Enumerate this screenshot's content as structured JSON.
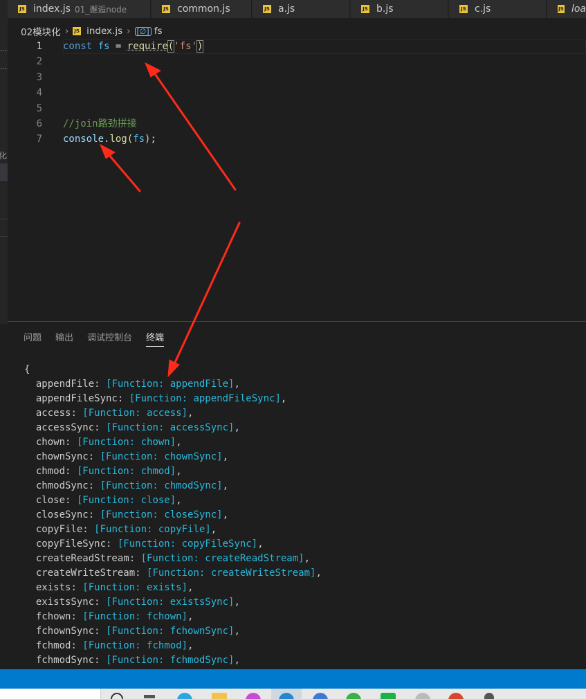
{
  "tabs": [
    {
      "name": "index.js",
      "sub": "01_邂逅node"
    },
    {
      "name": "common.js"
    },
    {
      "name": "a.js"
    },
    {
      "name": "b.js"
    },
    {
      "name": "c.js"
    },
    {
      "name": "loa"
    }
  ],
  "file_badge": "JS",
  "breadcrumb": {
    "folder": "02模块化",
    "file": "index.js",
    "symbol": "fs"
  },
  "left_strip": {
    "ellipsis_1": "...",
    "ellipsis_2": "...",
    "fragment": "化"
  },
  "editor": {
    "line_numbers": [
      "1",
      "2",
      "3",
      "4",
      "5",
      "6",
      "7"
    ],
    "line1": {
      "kw": "const",
      "var": "fs",
      "op": "=",
      "fn": "require",
      "open": "(",
      "str": "'fs'",
      "close": ")"
    },
    "line6": {
      "comment": "//join路劲拼接"
    },
    "line7": {
      "obj": "console",
      "dot": ".",
      "method": "log",
      "open": "(",
      "arg": "fs",
      "close": ");"
    }
  },
  "panel": {
    "tabs": [
      "问题",
      "输出",
      "调试控制台",
      "终端"
    ],
    "active_tab": "终端"
  },
  "terminal": {
    "open_brace": "{",
    "entries": [
      {
        "key": "appendFile",
        "fn": "appendFile"
      },
      {
        "key": "appendFileSync",
        "fn": "appendFileSync"
      },
      {
        "key": "access",
        "fn": "access"
      },
      {
        "key": "accessSync",
        "fn": "accessSync"
      },
      {
        "key": "chown",
        "fn": "chown"
      },
      {
        "key": "chownSync",
        "fn": "chownSync"
      },
      {
        "key": "chmod",
        "fn": "chmod"
      },
      {
        "key": "chmodSync",
        "fn": "chmodSync"
      },
      {
        "key": "close",
        "fn": "close"
      },
      {
        "key": "closeSync",
        "fn": "closeSync"
      },
      {
        "key": "copyFile",
        "fn": "copyFile"
      },
      {
        "key": "copyFileSync",
        "fn": "copyFileSync"
      },
      {
        "key": "createReadStream",
        "fn": "createReadStream"
      },
      {
        "key": "createWriteStream",
        "fn": "createWriteStream"
      },
      {
        "key": "exists",
        "fn": "exists"
      },
      {
        "key": "existsSync",
        "fn": "existsSync"
      },
      {
        "key": "fchown",
        "fn": "fchown"
      },
      {
        "key": "fchownSync",
        "fn": "fchownSync"
      },
      {
        "key": "fchmod",
        "fn": "fchmod"
      },
      {
        "key": "fchmodSync",
        "fn": "fchmodSync"
      }
    ]
  },
  "colors": {
    "statusbar": "#007acc",
    "annotation_arrow": "#ff2a1a",
    "terminal_function": "#29b8db",
    "js_badge": "#e8c33b"
  }
}
